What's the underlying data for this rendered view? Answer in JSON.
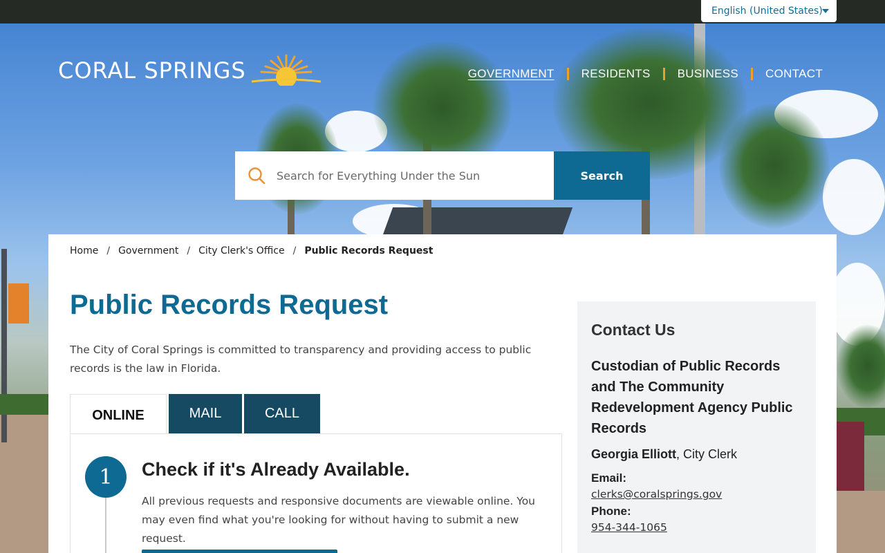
{
  "language": {
    "selected": "English (United States)"
  },
  "logo": {
    "text": "CORAL SPRINGS"
  },
  "nav": {
    "items": [
      {
        "label": "GOVERNMENT"
      },
      {
        "label": "RESIDENTS"
      },
      {
        "label": "BUSINESS"
      },
      {
        "label": "CONTACT"
      }
    ]
  },
  "search": {
    "placeholder": "Search for Everything Under the Sun",
    "button_label": "Search"
  },
  "breadcrumb": {
    "items": [
      {
        "label": "Home"
      },
      {
        "label": "Government"
      },
      {
        "label": "City Clerk's Office"
      },
      {
        "label": "Public Records Request"
      }
    ],
    "separator": "/"
  },
  "page": {
    "title": "Public Records Request",
    "intro": "The City of Coral Springs is committed to transparency and providing access to public records is the law in Florida."
  },
  "tabs": [
    {
      "label": "ONLINE"
    },
    {
      "label": "MAIL"
    },
    {
      "label": "CALL"
    }
  ],
  "step": {
    "number": "1",
    "title": "Check if it's Already Available.",
    "text": "All previous requests and responsive documents are viewable online. You may even find what you're looking for without having to submit a new request."
  },
  "contact": {
    "heading": "Contact Us",
    "subheading": "Custodian of Public Records and The Community Redevelopment Agency Public Records",
    "person_name": "Georgia Elliott",
    "person_role": ", City Clerk",
    "email_label": "Email:",
    "email": "clerks@coralsprings.gov",
    "phone_label": "Phone:",
    "phone": "954-344-1065"
  },
  "colors": {
    "brand_blue": "#0e6a93",
    "tab_dark": "#164a63",
    "nav_separator": "#f0a02a",
    "topbar": "#262a24"
  }
}
